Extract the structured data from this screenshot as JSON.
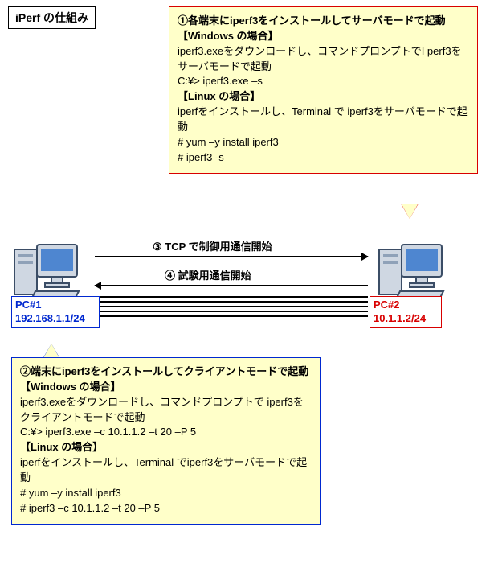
{
  "title": "iPerf の仕組み",
  "callout_server": {
    "heading": "①各端末にiperf3をインストールしてサーバモードで起動",
    "win_label": "【Windows の場合】",
    "win_line1": " iperf3.exeをダウンロードし、コマンドプロンプトでI perf3をサーバモードで起動",
    "win_cmd": "C:¥> iperf3.exe –s",
    "lin_label": "【Linux の場合】",
    "lin_line1": " iperfをインストールし、Terminal で iperf3をサーバモードで起動",
    "lin_cmd1": "# yum –y install iperf3",
    "lin_cmd2": "# iperf3 -s"
  },
  "callout_client": {
    "heading": "②端末にiperf3をインストールしてクライアントモードで起動",
    "win_label": "【Windows の場合】",
    "win_line1": " iperf3.exeをダウンロードし、コマンドプロンプトで iperf3をクライアントモードで起動",
    "win_cmd": "C:¥> iperf3.exe –c 10.1.1.2 –t 20 –P 5",
    "lin_label": "【Linux の場合】",
    "lin_line1": " iperfをインストールし、Terminal でiperf3をサーバモードで起動",
    "lin_cmd1": "# yum –y install iperf3",
    "lin_cmd2": "# iperf3 –c 10.1.1.2 –t 20 –P 5"
  },
  "pc1": {
    "name": "PC#1",
    "addr": "192.168.1.1/24"
  },
  "pc2": {
    "name": "PC#2",
    "addr": "10.1.1.2/24"
  },
  "steps": {
    "s3": "③ TCP で制御用通信開始",
    "s4": "④ 試験用通信開始"
  }
}
